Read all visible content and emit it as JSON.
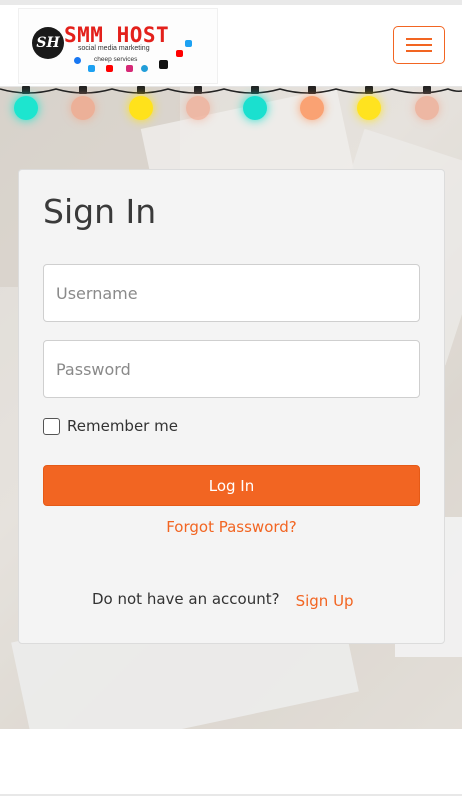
{
  "brand": {
    "badge": "SH",
    "title": "SMM HOST",
    "tagline": "social media marketing",
    "tagline2": "cheep services",
    "colors": {
      "title": "#e3201b",
      "accent": "#f26522"
    }
  },
  "nav": {
    "menu_icon": "hamburger-icon"
  },
  "lights": {
    "bulb_colors": [
      "#1de5cf",
      "#f3a587",
      "#ffe21b",
      "#f1ac94",
      "#1ae0cf",
      "#ff8a4c",
      "#ffe31f",
      "#f0a990"
    ]
  },
  "signin": {
    "title": "Sign In",
    "username_placeholder": "Username",
    "password_placeholder": "Password",
    "remember_label": "Remember me",
    "login_button": "Log In",
    "forgot_link": "Forgot Password?",
    "no_account_text": "Do not have an account?",
    "signup_link": "Sign Up"
  }
}
